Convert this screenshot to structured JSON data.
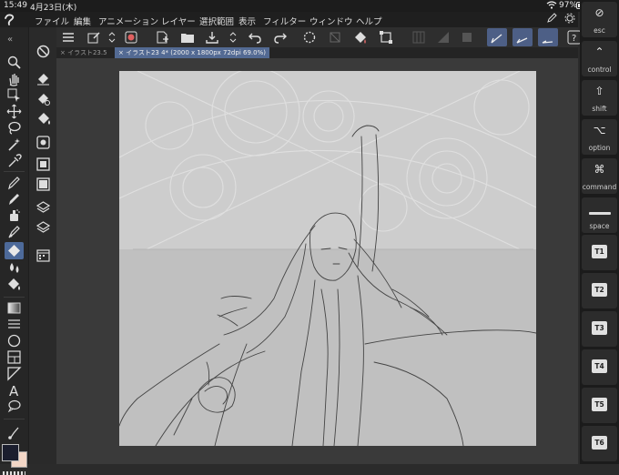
{
  "status_bar": {
    "time": "15:49",
    "date": "4月23日(木)",
    "battery": "97%"
  },
  "menu": {
    "items": [
      "ファイル",
      "編集",
      "アニメーション",
      "レイヤー",
      "選択範囲",
      "表示",
      "フィルター",
      "ウィンドウ",
      "ヘルプ"
    ]
  },
  "tabs": [
    {
      "label": "イラスト23.5"
    },
    {
      "label": "イラスト23 4* (2000 x 1800px 72dpi 69.0%)"
    }
  ],
  "colors": {
    "main_color": "#1b1e2e",
    "sub_color": "#f2d6c6",
    "accent": "#536a93"
  },
  "keys": {
    "esc": "esc",
    "control": "control",
    "shift": "shift",
    "option": "option",
    "command": "command",
    "space": "space",
    "t1": "T1",
    "t2": "T2",
    "t3": "T3",
    "t4": "T4",
    "t5": "T5",
    "t6": "T6"
  },
  "document": {
    "name": "イラスト23 4*",
    "size": "2000 x 1800px",
    "resolution": "72dpi",
    "zoom": "69.0%"
  }
}
